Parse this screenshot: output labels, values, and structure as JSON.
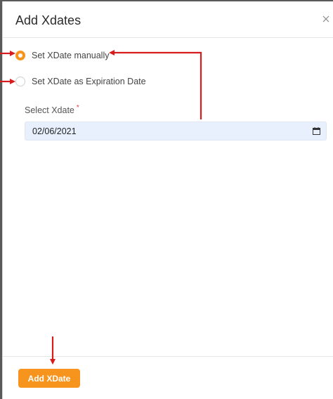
{
  "modal": {
    "title": "Add Xdates",
    "close_icon": "close-icon"
  },
  "options": [
    {
      "label": "Set XDate manually",
      "checked": true
    },
    {
      "label": "Set XDate as Expiration Date",
      "checked": false
    }
  ],
  "field": {
    "label": "Select Xdate",
    "required_mark": "*",
    "value": "02/06/2021",
    "icon": "calendar-icon"
  },
  "footer": {
    "add_button_label": "Add XDate"
  },
  "colors": {
    "accent": "#f7941d",
    "annotation_arrow": "#d61c1c",
    "input_bg": "#e8f0fe"
  }
}
